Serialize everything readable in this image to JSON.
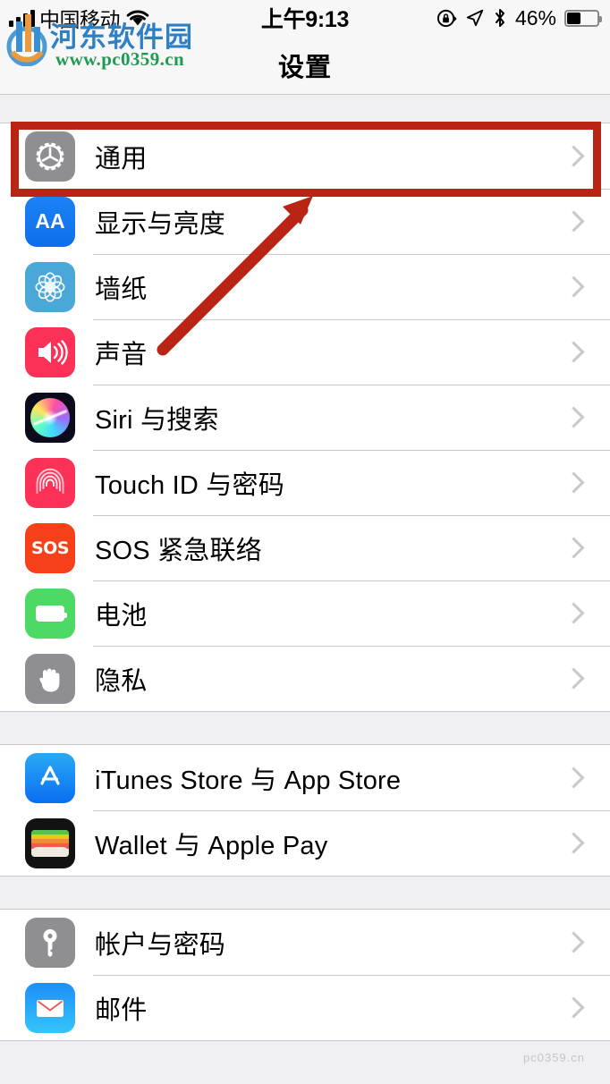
{
  "status_bar": {
    "carrier": "中国移动",
    "time": "上午9:13",
    "battery_percent": "46%",
    "battery_level": 46,
    "icons": [
      "signal-bars-icon",
      "wifi-icon",
      "rotation-lock-icon",
      "location-arrow-icon",
      "bluetooth-icon",
      "battery-icon"
    ]
  },
  "nav": {
    "title": "设置"
  },
  "groups": [
    {
      "id": "group-system",
      "rows": [
        {
          "label": "通用",
          "icon": "gear-icon",
          "icon_class": "ic-gear",
          "highlighted": true
        },
        {
          "label": "显示与亮度",
          "icon": "display-brightness-icon",
          "icon_class": "ic-aa"
        },
        {
          "label": "墙纸",
          "icon": "wallpaper-icon",
          "icon_class": "ic-wall"
        },
        {
          "label": "声音",
          "icon": "sounds-icon",
          "icon_class": "ic-sound"
        },
        {
          "label": "Siri 与搜索",
          "icon": "siri-icon",
          "icon_class": "ic-siri"
        },
        {
          "label": "Touch ID 与密码",
          "icon": "touch-id-icon",
          "icon_class": "ic-touch"
        },
        {
          "label": "SOS 紧急联络",
          "icon": "sos-icon",
          "icon_class": "ic-sos"
        },
        {
          "label": "电池",
          "icon": "battery-settings-icon",
          "icon_class": "ic-batt"
        },
        {
          "label": "隐私",
          "icon": "privacy-hand-icon",
          "icon_class": "ic-priv"
        }
      ]
    },
    {
      "id": "group-stores",
      "rows": [
        {
          "label": "iTunes Store 与 App Store",
          "icon": "app-store-icon",
          "icon_class": "ic-store"
        },
        {
          "label": "Wallet 与 Apple Pay",
          "icon": "wallet-icon",
          "icon_class": "ic-wallet"
        }
      ]
    },
    {
      "id": "group-accounts",
      "rows": [
        {
          "label": "帐户与密码",
          "icon": "key-icon",
          "icon_class": "ic-key"
        },
        {
          "label": "邮件",
          "icon": "mail-icon",
          "icon_class": "ic-mail"
        }
      ]
    }
  ],
  "annotations": {
    "highlight_color": "#b92415",
    "highlight_target": "通用",
    "arrow_color": "#b92415",
    "arrow_points_to": "通用"
  },
  "watermark": {
    "site_name": "河东软件园",
    "url": "www.pc0359.cn"
  },
  "icon_glyphs": {
    "display_brightness": "AA",
    "sos": "SOS"
  }
}
